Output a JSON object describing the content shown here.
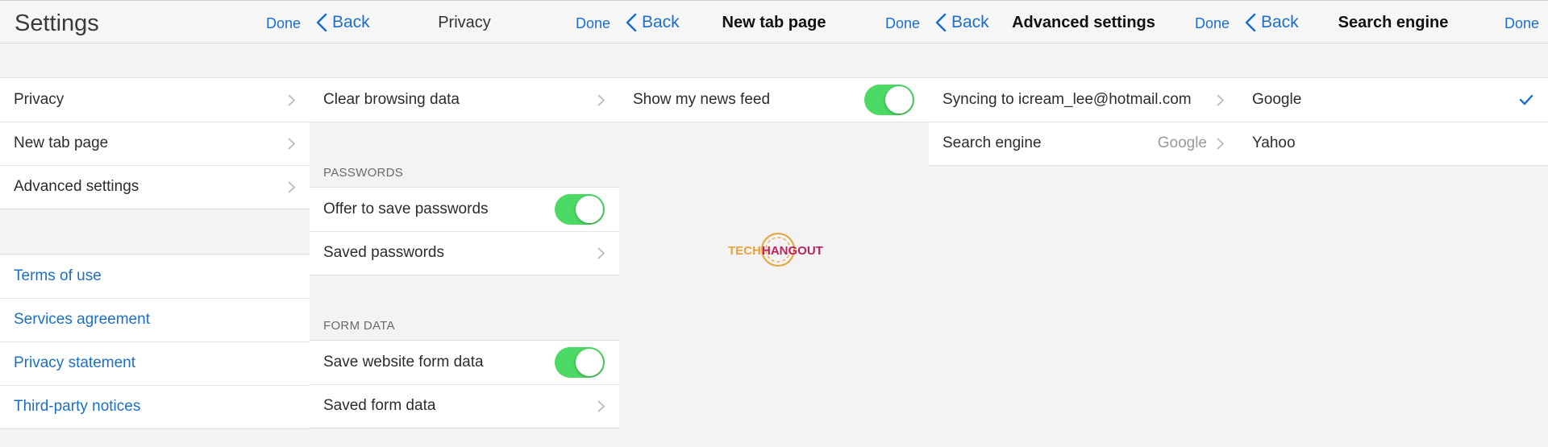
{
  "settings": {
    "title": "Settings",
    "done": "Done",
    "items": [
      {
        "label": "Privacy"
      },
      {
        "label": "New tab page"
      },
      {
        "label": "Advanced settings"
      }
    ],
    "links": [
      {
        "label": "Terms of use"
      },
      {
        "label": "Services agreement"
      },
      {
        "label": "Privacy statement"
      },
      {
        "label": "Third-party notices"
      }
    ]
  },
  "privacy": {
    "back": "Back",
    "title": "Privacy",
    "done": "Done",
    "clear_browsing_data": "Clear browsing data",
    "passwords_header": "PASSWORDS",
    "offer_to_save_passwords": "Offer to save passwords",
    "offer_to_save_passwords_on": true,
    "saved_passwords": "Saved passwords",
    "form_data_header": "FORM DATA",
    "save_website_form_data": "Save website form data",
    "save_website_form_data_on": true,
    "saved_form_data": "Saved form data"
  },
  "new_tab": {
    "back": "Back",
    "title": "New tab page",
    "done": "Done",
    "show_news_feed": "Show my news feed",
    "show_news_feed_on": true,
    "watermark": "TechHangout"
  },
  "advanced": {
    "back": "Back",
    "title": "Advanced settings",
    "done": "Done",
    "syncing": "Syncing to icream_lee@hotmail.com",
    "search_engine_label": "Search engine",
    "search_engine_value": "Google"
  },
  "search_engine": {
    "back": "Back",
    "title": "Search engine",
    "done": "Done",
    "options": [
      {
        "label": "Google",
        "selected": true
      },
      {
        "label": "Yahoo",
        "selected": false
      }
    ]
  },
  "colors": {
    "accent": "#1b6fd1",
    "toggle_on": "#4cd964",
    "link": "#1d6fc2"
  }
}
